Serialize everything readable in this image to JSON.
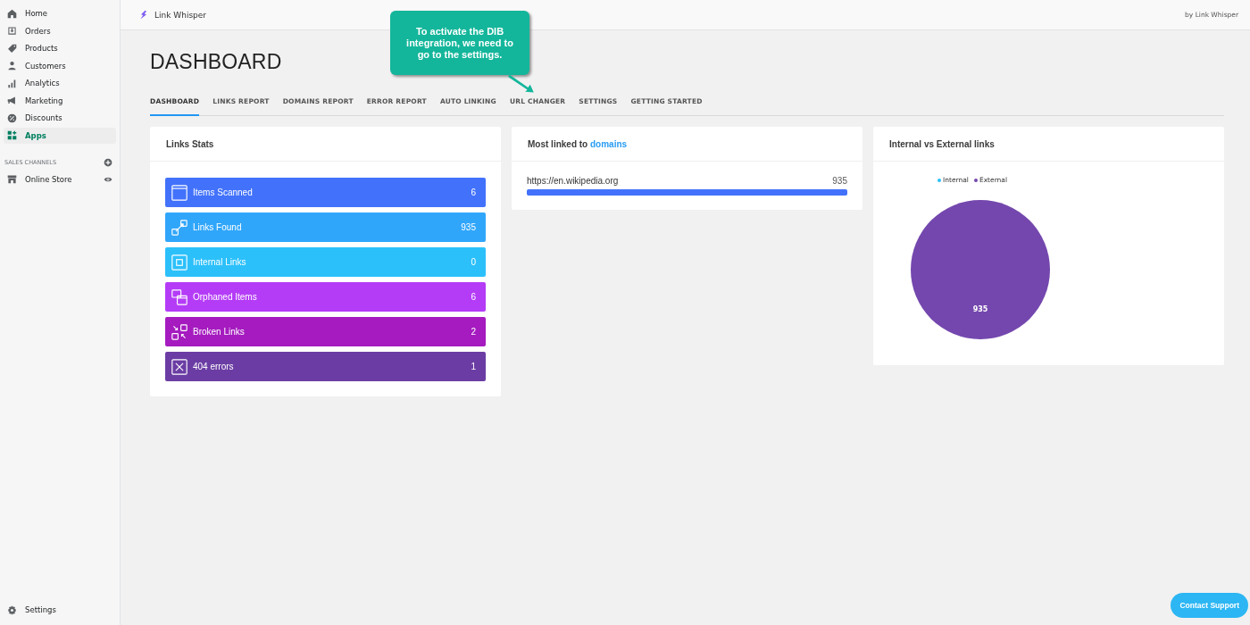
{
  "sidebar": {
    "items": [
      {
        "label": "Home",
        "selected": false
      },
      {
        "label": "Orders",
        "selected": false
      },
      {
        "label": "Products",
        "selected": false
      },
      {
        "label": "Customers",
        "selected": false
      },
      {
        "label": "Analytics",
        "selected": false
      },
      {
        "label": "Marketing",
        "selected": false
      },
      {
        "label": "Discounts",
        "selected": false
      },
      {
        "label": "Apps",
        "selected": true
      }
    ],
    "section_title": "SALES CHANNELS",
    "channels": [
      {
        "label": "Online Store"
      }
    ],
    "footer": {
      "label": "Settings"
    }
  },
  "topbar": {
    "app_name": "Link Whisper",
    "byline": "by Link Whisper"
  },
  "callout": {
    "text": "To activate the DIB integration, we need to go to the settings."
  },
  "page_title": "DASHBOARD",
  "tabs": [
    {
      "label": "DASHBOARD",
      "selected": true
    },
    {
      "label": "LINKS REPORT",
      "selected": false
    },
    {
      "label": "DOMAINS REPORT",
      "selected": false
    },
    {
      "label": "ERROR REPORT",
      "selected": false
    },
    {
      "label": "AUTO LINKING",
      "selected": false
    },
    {
      "label": "URL CHANGER",
      "selected": false
    },
    {
      "label": "SETTINGS",
      "selected": false
    },
    {
      "label": "GETTING STARTED",
      "selected": false
    }
  ],
  "links_stats": {
    "title": "Links Stats",
    "rows": [
      {
        "label": "Items Scanned",
        "value": "6",
        "kind": "window",
        "color": "#4272fb"
      },
      {
        "label": "Links Found",
        "value": "935",
        "kind": "link",
        "color": "#30a6fb"
      },
      {
        "label": "Internal Links",
        "value": "0",
        "kind": "square",
        "color": "#2cc0fb"
      },
      {
        "label": "Orphaned Items",
        "value": "6",
        "kind": "windows",
        "color": "#b43cf7"
      },
      {
        "label": "Broken Links",
        "value": "2",
        "kind": "broken",
        "color": "#a51bbf"
      },
      {
        "label": "404 errors",
        "value": "1",
        "kind": "cross",
        "color": "#6b3da4"
      }
    ]
  },
  "domains": {
    "title_prefix": "Most linked to",
    "title_link": "domains",
    "rows": [
      {
        "domain": "https://en.wikipedia.org",
        "count": "935",
        "level": 1
      }
    ]
  },
  "internal_external": {
    "title": "Internal vs External links",
    "chart_data": {
      "type": "pie",
      "categories": [
        "Internal",
        "External"
      ],
      "values": [
        0,
        935
      ],
      "colors": [
        "#29c1f8",
        "#7447ae"
      ],
      "data_labels": true
    }
  },
  "support_button": {
    "label": "Contact Support"
  }
}
